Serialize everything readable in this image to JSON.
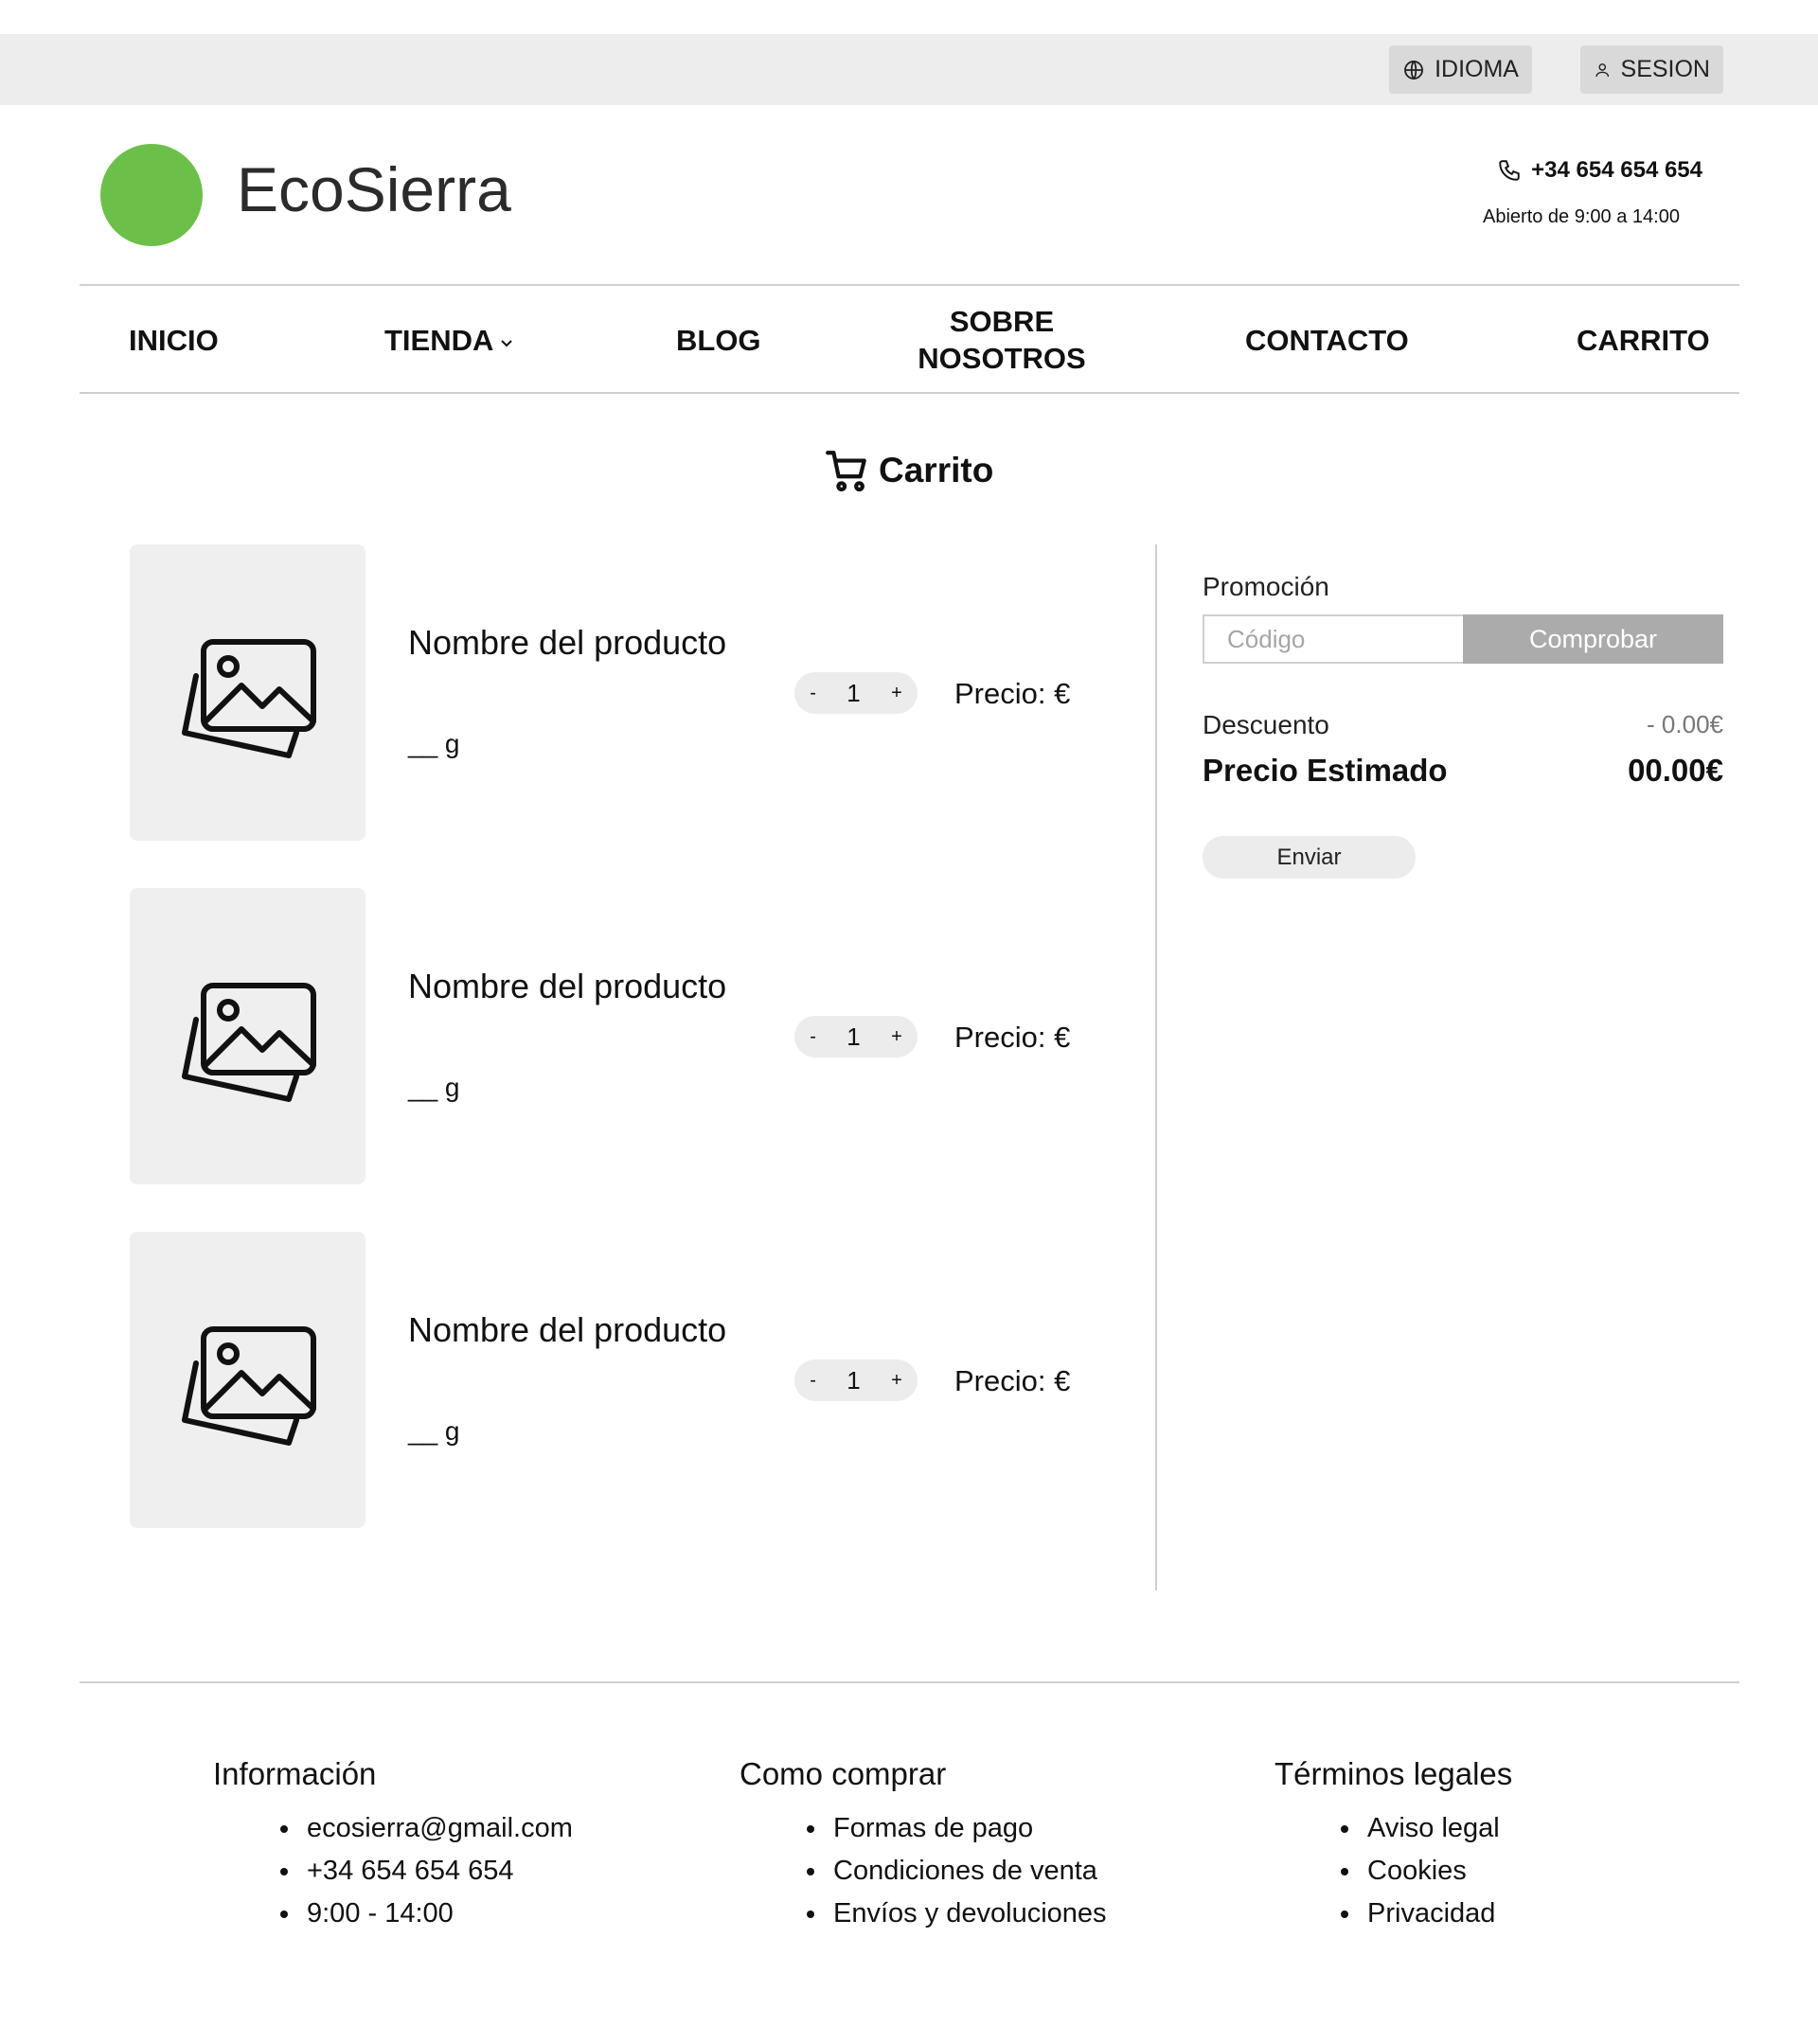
{
  "topbar": {
    "language_label": "IDIOMA",
    "session_label": "SESION"
  },
  "header": {
    "brand": "EcoSierra",
    "phone": "+34 654 654 654",
    "hours": "Abierto de 9:00 a 14:00",
    "brand_color": "#6cc04a"
  },
  "nav": {
    "items": [
      {
        "label": "INICIO"
      },
      {
        "label": "TIENDA"
      },
      {
        "label": "BLOG"
      },
      {
        "label": "SOBRE NOSOTROS"
      },
      {
        "label": "CONTACTO"
      },
      {
        "label": "CARRITO"
      }
    ]
  },
  "cart": {
    "title": "Carrito",
    "products": [
      {
        "name": "Nombre del producto",
        "weight": "__ g",
        "quantity": "1",
        "minus": "-",
        "plus": "+",
        "price": "Precio: €"
      },
      {
        "name": "Nombre del producto",
        "weight": "__ g",
        "quantity": "1",
        "minus": "-",
        "plus": "+",
        "price": "Precio: €"
      },
      {
        "name": "Nombre del producto",
        "weight": "__ g",
        "quantity": "1",
        "minus": "-",
        "plus": "+",
        "price": "Precio: €"
      }
    ]
  },
  "summary": {
    "promo_label": "Promoción",
    "promo_placeholder": "Código",
    "check_label": "Comprobar",
    "discount_label": "Descuento",
    "discount_value": "-  0.00€",
    "estimated_label": "Precio Estimado",
    "estimated_value": "00.00€",
    "send_label": "Enviar"
  },
  "footer": {
    "info": {
      "title": "Información",
      "items": [
        "ecosierra@gmail.com",
        "+34 654 654 654",
        "9:00 - 14:00"
      ]
    },
    "howto": {
      "title": "Como comprar",
      "items": [
        "Formas de pago",
        "Condiciones de venta",
        "Envíos y devoluciones"
      ]
    },
    "legal": {
      "title": "Términos legales",
      "items": [
        "Aviso legal",
        "Cookies",
        "Privacidad"
      ]
    }
  }
}
